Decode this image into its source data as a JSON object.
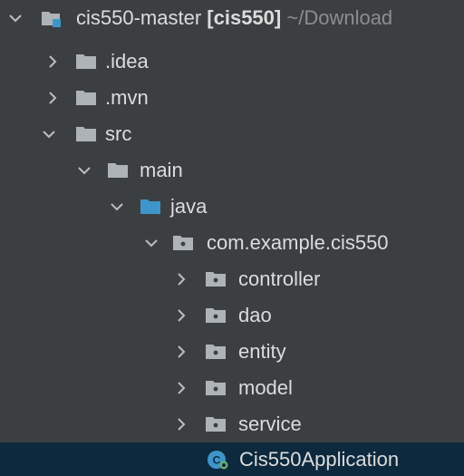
{
  "colors": {
    "background": "#3c3f41",
    "selection": "#0d293e",
    "text": "#dcdcdc",
    "muted_text": "#8d8d8d",
    "folder": "#aeb3b8",
    "source_folder": "#3e95c9",
    "module_badge": "#3e95c9"
  },
  "tree": {
    "root": {
      "label": "cis550-master",
      "module": "[cis550]",
      "path": "~/Download",
      "icon": "module-folder-icon",
      "expanded": true
    },
    "idea": {
      "label": ".idea",
      "icon": "folder-icon",
      "expanded": false
    },
    "mvn": {
      "label": ".mvn",
      "icon": "folder-icon",
      "expanded": false
    },
    "src": {
      "label": "src",
      "icon": "folder-icon",
      "expanded": true
    },
    "main": {
      "label": "main",
      "icon": "folder-icon",
      "expanded": true
    },
    "java": {
      "label": "java",
      "icon": "source-root-icon",
      "expanded": true
    },
    "pkg": {
      "label": "com.example.cis550",
      "icon": "package-icon",
      "expanded": true
    },
    "controller": {
      "label": "controller",
      "icon": "package-icon",
      "expanded": false
    },
    "dao": {
      "label": "dao",
      "icon": "package-icon",
      "expanded": false
    },
    "entity": {
      "label": "entity",
      "icon": "package-icon",
      "expanded": false
    },
    "model": {
      "label": "model",
      "icon": "package-icon",
      "expanded": false
    },
    "service": {
      "label": "service",
      "icon": "package-icon",
      "expanded": false
    },
    "app": {
      "label": "Cis550Application",
      "icon": "spring-boot-class-icon",
      "selected": true
    }
  }
}
